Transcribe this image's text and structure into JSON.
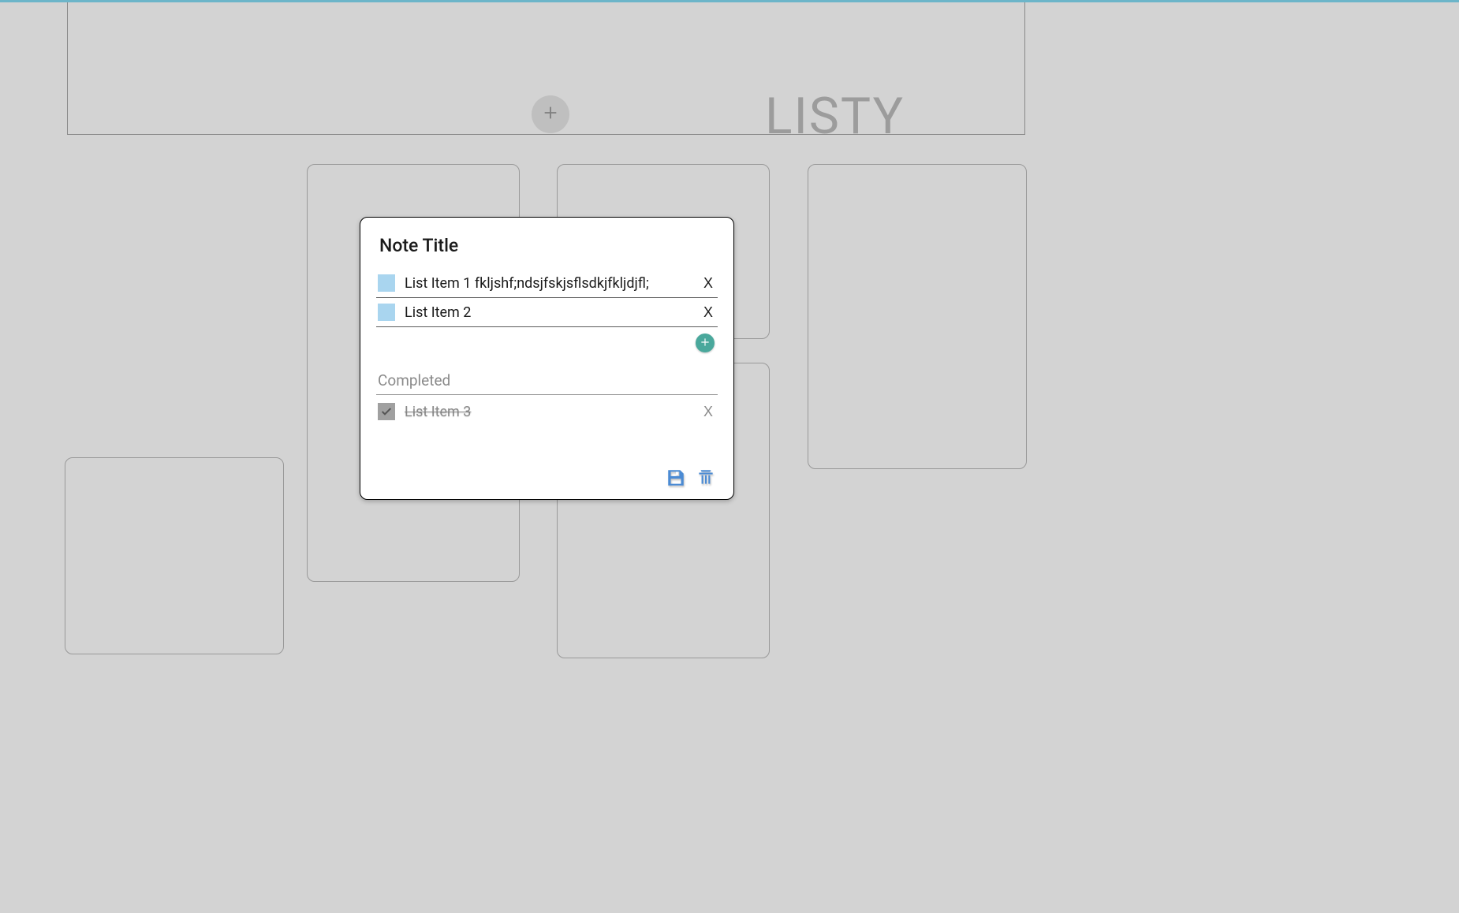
{
  "brand": "LISTY",
  "modal": {
    "title": "Note Title",
    "active_items": [
      {
        "text": "List Item 1 fkljshf;ndsjfskjsflsdkjfkljdjfl;",
        "delete_label": "X"
      },
      {
        "text": "List Item 2",
        "delete_label": "X"
      }
    ],
    "completed_header": "Completed",
    "completed_items": [
      {
        "text": "List Item 3",
        "delete_label": "X"
      }
    ]
  },
  "colors": {
    "accent_blue": "#4b8bd4",
    "accent_teal": "#4aa89c",
    "checkbox_light": "#a9d5ef"
  }
}
